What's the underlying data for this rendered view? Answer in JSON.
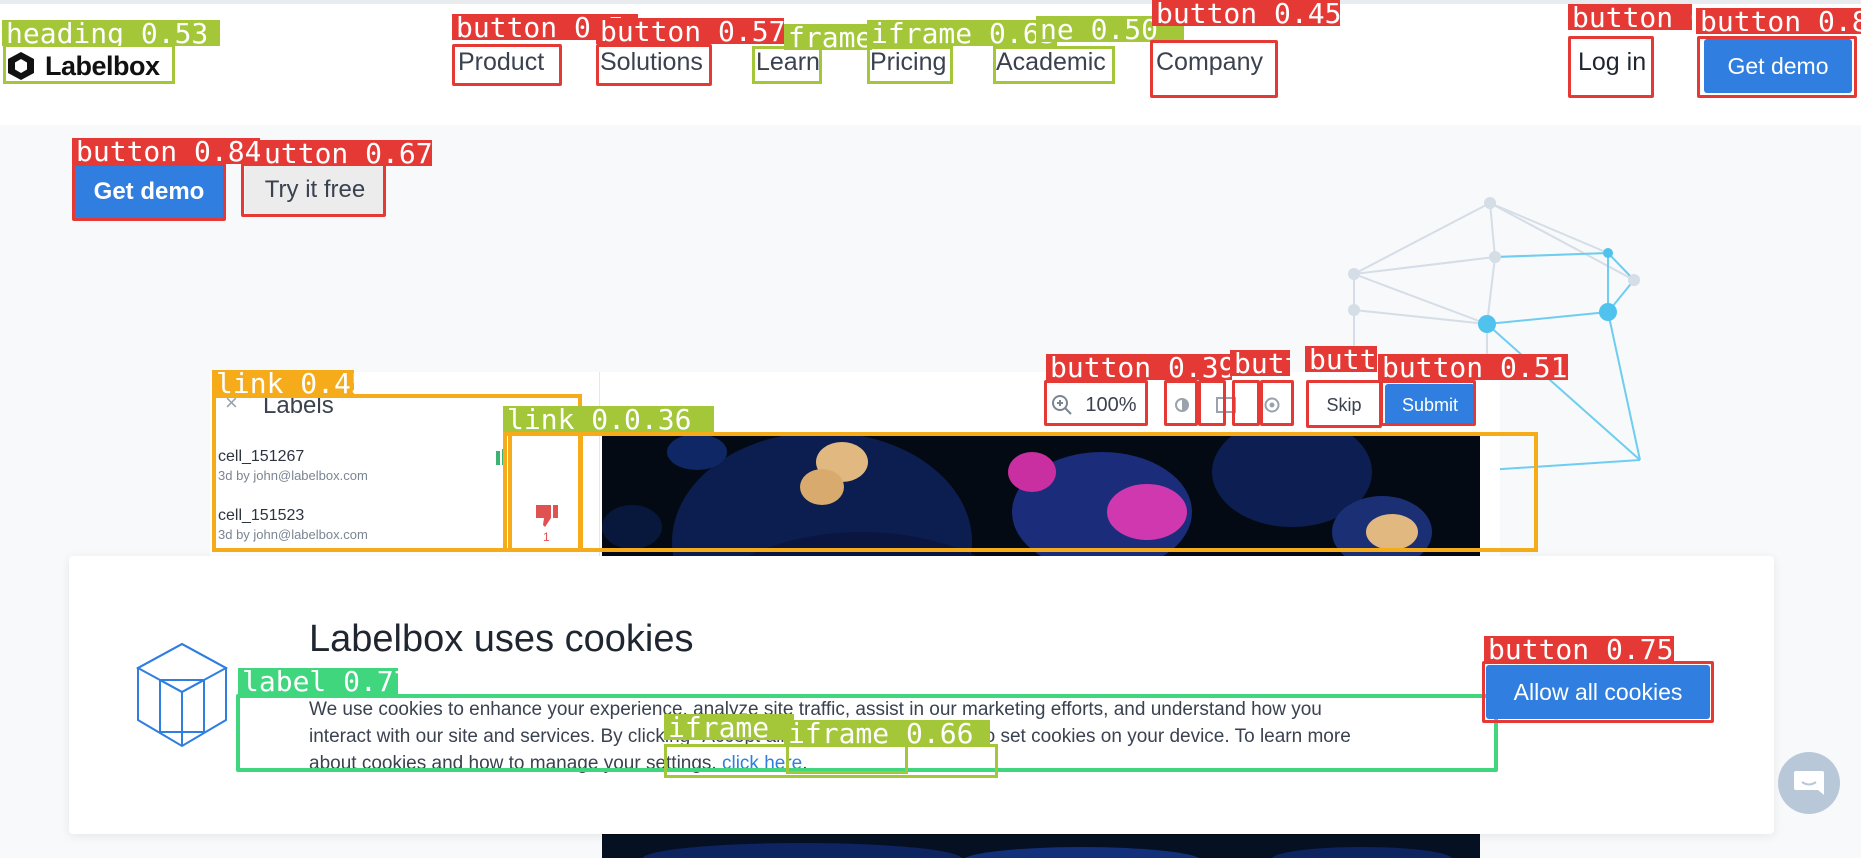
{
  "brand": {
    "name": "Labelbox"
  },
  "nav": {
    "items": [
      "Product",
      "Solutions",
      "Learn",
      "Pricing",
      "Academic",
      "Company"
    ],
    "login": "Log in",
    "get_demo": "Get demo"
  },
  "hero": {
    "get_demo": "Get demo",
    "try_free": "Try it free"
  },
  "tool": {
    "labels_title": "Labels",
    "close": "×",
    "rows": [
      {
        "name": "cell_151267",
        "meta": "3d by john@labelbox.com"
      },
      {
        "name": "cell_151523",
        "meta": "3d by john@labelbox.com"
      }
    ],
    "thumbs_down_count": "1",
    "zoom": "100%",
    "skip": "Skip",
    "submit": "Submit"
  },
  "cookie": {
    "title": "Labelbox uses cookies",
    "body_1": "We use cookies to enhance your experience, analyze site traffic, assist in our marketing efforts, and understand how you interact with our site and services. By cl",
    "body_2": "icking \"Accept all cookies\", you consent to set cookies on your device. To learn more about cookies and how to manage your settings, ",
    "link": "click here",
    "body_end": ".",
    "allow_all": "Allow all cookies"
  },
  "detections": [
    {
      "label": "heading 0.53"
    },
    {
      "label": "button 0.5"
    },
    {
      "label": "button 0.57"
    },
    {
      "label": "frame"
    },
    {
      "label": "iframe 0.65"
    },
    {
      "label": "ne 0.50"
    },
    {
      "label": "button 0.45"
    },
    {
      "label": "button 0"
    },
    {
      "label": "button 0.8"
    },
    {
      "label": "button 0.84"
    },
    {
      "label": "utton 0.67"
    },
    {
      "label": "link 0.45"
    },
    {
      "label": "link 0.41"
    },
    {
      "label": "0.36"
    },
    {
      "label": "button 0.39"
    },
    {
      "label": "butt"
    },
    {
      "label": "butt"
    },
    {
      "label": "button 0.51"
    },
    {
      "label": "button 0.75"
    },
    {
      "label": "label 0.77"
    },
    {
      "label": "iframe"
    },
    {
      "label": "iframe 0.66"
    }
  ],
  "colors": {
    "primary": "#2f7ee0",
    "detect_red": "#e53935",
    "detect_lime": "#a4c639",
    "detect_amber": "#f5ab1a",
    "detect_green": "#3fd67e"
  }
}
